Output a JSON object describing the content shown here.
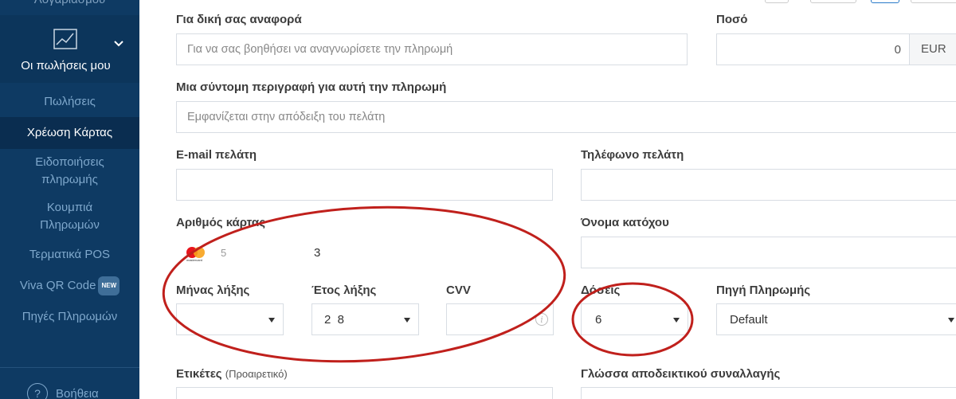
{
  "sidebar": {
    "top_partial": "Λογαριασμού",
    "sales_section": "Οι πωλήσεις μου",
    "items": [
      {
        "label": "Πωλήσεις",
        "active": false
      },
      {
        "label": "Χρέωση Κάρτας",
        "active": true
      },
      {
        "label": "Ειδοποιήσεις πληρωμής",
        "active": false
      },
      {
        "label": "Κουμπιά Πληρωμών",
        "active": false
      },
      {
        "label": "Τερματικά POS",
        "active": false
      },
      {
        "label": "Viva QR Code",
        "badge": "NEW",
        "active": false
      },
      {
        "label": "Πηγές Πληρωμών",
        "active": false
      }
    ],
    "help": "Βοήθεια",
    "help_icon": "?"
  },
  "form": {
    "reference_label": "Για δική σας αναφορά",
    "reference_placeholder": "Για να σας βοηθήσει να αναγνωρίσετε την πληρωμή",
    "amount_label": "Ποσό",
    "amount_value": "0",
    "currency": "EUR",
    "description_label": "Μια σύντομη περιγραφή για αυτή την πληρωμή",
    "description_placeholder": "Εμφανίζεται στην απόδειξη του πελάτη",
    "email_label": "E-mail πελάτη",
    "phone_label": "Τηλέφωνο πελάτη",
    "card_number_label": "Αριθμός κάρτας",
    "card_number_value": "5",
    "card_number_value_end": "3",
    "card_brand_text": "mastercard",
    "holder_label": "Όνομα κατόχου",
    "expiry_month_label": "Μήνας λήξης",
    "expiry_year_label": "Έτος λήξης",
    "expiry_year_value": "2  8",
    "cvv_label": "CVV",
    "installments_label": "Δόσεις",
    "installments_value": "6",
    "payment_source_label": "Πηγή Πληρωμής",
    "payment_source_value": "Default",
    "tags_label": "Ετικέτες",
    "tags_optional": "(Προαιρετικό)",
    "receipt_language_label": "Γλώσσα αποδεικτικού συναλλαγής"
  },
  "colors": {
    "sidebar_bg": "#0e3a63",
    "sidebar_active": "#0a2d50",
    "annotation_red": "#c0201c"
  },
  "icons": [
    "chart-icon",
    "chevron-down-icon",
    "mastercard-icon",
    "info-icon",
    "help-icon",
    "caret-down-icon"
  ]
}
